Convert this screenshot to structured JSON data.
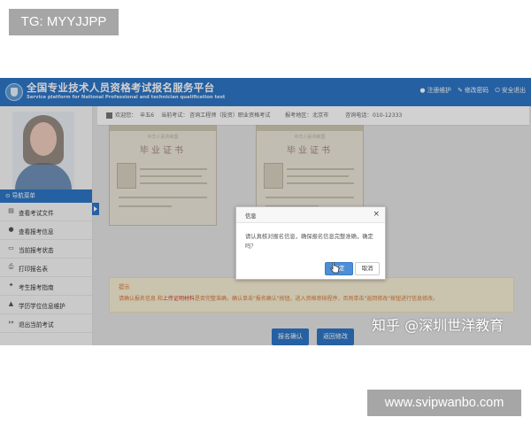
{
  "tags": {
    "top": "TG: MYYJJPP",
    "bottom": "www.svipwanbo.com"
  },
  "header": {
    "title": "全国专业技术人员资格考试报名服务平台",
    "subtitle": "Service platform for National Professional and technician qualification test",
    "links": [
      {
        "icon": "info-circle-icon",
        "label": "注册维护"
      },
      {
        "icon": "edit-icon",
        "label": "修改密码"
      },
      {
        "icon": "power-icon",
        "label": "安全退出"
      }
    ]
  },
  "infobar": {
    "welcome": "欢迎您：",
    "user": "辛五6",
    "current_exam_label": "当前考试：",
    "current_exam": "咨询工程师（投资）职业资格考试",
    "region_label": "报考地区：",
    "region": "北京市",
    "phone_label": "咨询电话：",
    "phone": "010-12333"
  },
  "sidebar": {
    "nav_header": "导航菜单",
    "items": [
      {
        "label": "查看考试文件",
        "icon": "document-icon"
      },
      {
        "label": "查看报考信息",
        "icon": "info-icon"
      },
      {
        "label": "当前报考状态",
        "icon": "status-icon"
      },
      {
        "label": "打印报名表",
        "icon": "print-icon"
      },
      {
        "label": "考生报考指南",
        "icon": "guide-icon"
      },
      {
        "label": "学历学位信息维护",
        "icon": "graduation-icon"
      },
      {
        "label": "退出当前考试",
        "icon": "exit-icon"
      }
    ]
  },
  "certificates": [
    {
      "small": "中华人民共和国",
      "title": "毕业证书"
    },
    {
      "small": "中华人民共和国",
      "title": "毕业证书"
    }
  ],
  "notice": {
    "title": "提示",
    "text_before": "请确认报名信息 和",
    "text_emphasis": "上传证明材料",
    "text_after": "是否完整准确，确认单击\"报名确认\"按钮，进入资格审核程序，否则单击\"返回修改\"按钮进行信息修改。"
  },
  "buttons": {
    "confirm": "报名确认",
    "back": "返回修改"
  },
  "dialog": {
    "title": "信息",
    "close": "×",
    "message": "请认真核对报名信息，确保报名信息完整准确，确定吗？",
    "ok": "确定",
    "cancel": "取消"
  },
  "watermark": "知乎 @深圳世洋教育",
  "colors": {
    "brand_blue": "#2e76c6",
    "notice_text": "#d57a38",
    "notice_emphasis": "#d2382c",
    "notice_bg": "#f7eed5"
  }
}
